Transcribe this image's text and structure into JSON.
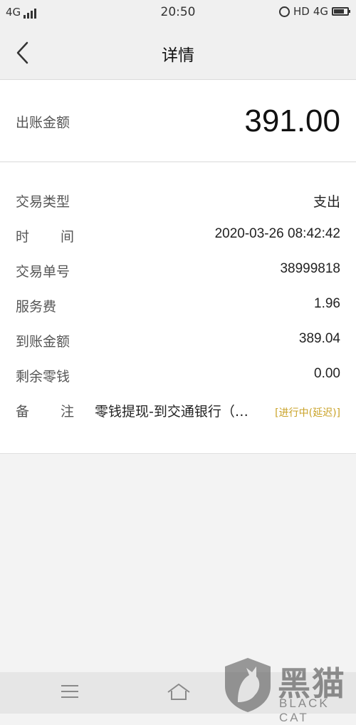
{
  "status_bar": {
    "network_left": "4G",
    "time": "20:50",
    "hd_label": "HD",
    "network_right": "4G"
  },
  "header": {
    "back_icon": "chevron-left-icon",
    "title": "详情"
  },
  "amount": {
    "label": "出账金额",
    "value": "391.00"
  },
  "details": {
    "rows": [
      {
        "label": "交易类型",
        "value": "支出"
      },
      {
        "label_chars": [
          "时",
          "间"
        ],
        "value": "2020-03-26 08:42:42"
      },
      {
        "label": "交易单号",
        "value": "38999818"
      },
      {
        "label": "服务费",
        "value": "1.96"
      },
      {
        "label": "到账金额",
        "value": "389.04"
      },
      {
        "label": "剩余零钱",
        "value": "0.00"
      }
    ],
    "note": {
      "label_chars": [
        "备",
        "注"
      ],
      "text": "零钱提现-到交通银行（…",
      "status": "[进行中(延迟)]"
    }
  },
  "bottom_nav": {
    "menu_icon": "menu-icon",
    "home_icon": "home-icon"
  },
  "watermark": {
    "text": "黑猫",
    "subtext": "BLACK CAT"
  },
  "colors": {
    "background": "#f3f3f3",
    "card": "#ffffff",
    "status_accent": "#c9a227"
  }
}
